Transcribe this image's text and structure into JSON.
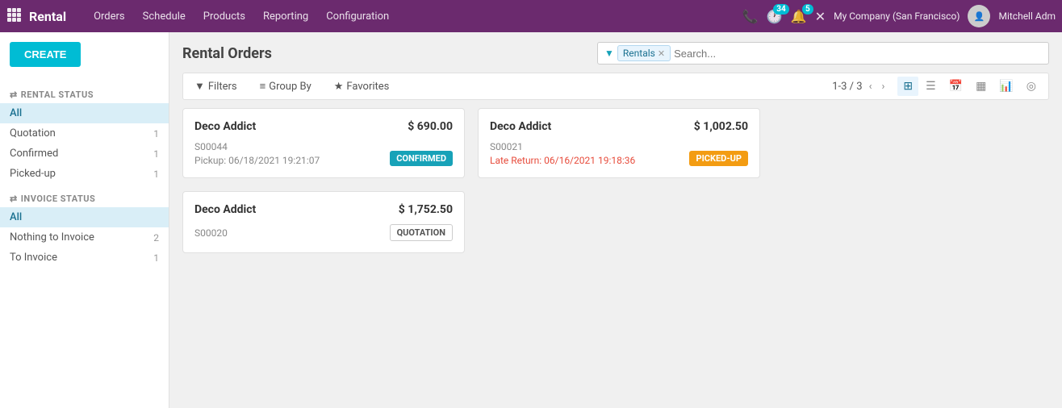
{
  "app": {
    "name": "Rental",
    "nav_items": [
      "Orders",
      "Schedule",
      "Products",
      "Reporting",
      "Configuration"
    ]
  },
  "topnav": {
    "company": "My Company (San Francisco)",
    "user": "Mitchell Adm",
    "phone_icon": "📞",
    "clock_badge": "34",
    "bell_badge": "5"
  },
  "page": {
    "title": "Rental Orders",
    "create_label": "CREATE"
  },
  "search": {
    "filter_tag": "Rentals",
    "placeholder": "Search..."
  },
  "toolbar": {
    "filters_label": "Filters",
    "group_by_label": "Group By",
    "favorites_label": "Favorites",
    "pagination": "1-3 / 3"
  },
  "sidebar": {
    "rental_status_label": "RENTAL STATUS",
    "invoice_status_label": "INVOICE STATUS",
    "rental_items": [
      {
        "label": "All",
        "count": null,
        "active": true
      },
      {
        "label": "Quotation",
        "count": "1",
        "active": false
      },
      {
        "label": "Confirmed",
        "count": "1",
        "active": false
      },
      {
        "label": "Picked-up",
        "count": "1",
        "active": false
      }
    ],
    "invoice_items": [
      {
        "label": "All",
        "count": null,
        "active": true
      },
      {
        "label": "Nothing to Invoice",
        "count": "2",
        "active": false
      },
      {
        "label": "To Invoice",
        "count": "1",
        "active": false
      }
    ]
  },
  "cards": [
    {
      "id": 0,
      "name": "Deco Addict",
      "amount": "$ 690.00",
      "order": "S00044",
      "date_label": "Pickup:",
      "date": "06/18/2021 19:21:07",
      "date_is_late": false,
      "status": "Confirmed",
      "status_class": "badge-confirmed"
    },
    {
      "id": 1,
      "name": "Deco Addict",
      "amount": "$ 1,002.50",
      "order": "S00021",
      "date_label": "Late Return:",
      "date": "06/16/2021 19:18:36",
      "date_is_late": true,
      "status": "Picked-up",
      "status_class": "badge-pickedup"
    },
    {
      "id": 2,
      "name": "Deco Addict",
      "amount": "$ 1,752.50",
      "order": "S00020",
      "date_label": "",
      "date": "",
      "date_is_late": false,
      "status": "Quotation",
      "status_class": "badge-quotation"
    }
  ]
}
